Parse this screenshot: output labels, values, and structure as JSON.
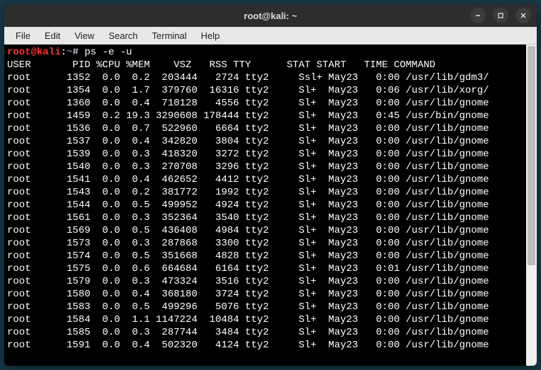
{
  "window": {
    "title": "root@kali: ~"
  },
  "menu": {
    "items": [
      "File",
      "Edit",
      "View",
      "Search",
      "Terminal",
      "Help"
    ]
  },
  "prompt": {
    "user": "root@kali",
    "sep1": ":",
    "path": "~",
    "sep2": "# ",
    "command": "ps -e -u"
  },
  "columns": "USER       PID %CPU %MEM    VSZ   RSS TTY      STAT START   TIME COMMAND",
  "processes": [
    {
      "user": "root",
      "pid": 1352,
      "cpu": "0.0",
      "mem": "0.2",
      "vsz": 203444,
      "rss": 2724,
      "tty": "tty2",
      "stat": "Ssl+",
      "start": "May23",
      "time": "0:00",
      "command": "/usr/lib/gdm3/"
    },
    {
      "user": "root",
      "pid": 1354,
      "cpu": "0.0",
      "mem": "1.7",
      "vsz": 379760,
      "rss": 16316,
      "tty": "tty2",
      "stat": "Sl+",
      "start": "May23",
      "time": "0:06",
      "command": "/usr/lib/xorg/"
    },
    {
      "user": "root",
      "pid": 1360,
      "cpu": "0.0",
      "mem": "0.4",
      "vsz": 710128,
      "rss": 4556,
      "tty": "tty2",
      "stat": "Sl+",
      "start": "May23",
      "time": "0:00",
      "command": "/usr/lib/gnome"
    },
    {
      "user": "root",
      "pid": 1459,
      "cpu": "0.2",
      "mem": "19.3",
      "vsz": 3290608,
      "rss": 178444,
      "tty": "tty2",
      "stat": "Sl+",
      "start": "May23",
      "time": "0:45",
      "command": "/usr/bin/gnome"
    },
    {
      "user": "root",
      "pid": 1536,
      "cpu": "0.0",
      "mem": "0.7",
      "vsz": 522960,
      "rss": 6664,
      "tty": "tty2",
      "stat": "Sl+",
      "start": "May23",
      "time": "0:00",
      "command": "/usr/lib/gnome"
    },
    {
      "user": "root",
      "pid": 1537,
      "cpu": "0.0",
      "mem": "0.4",
      "vsz": 342820,
      "rss": 3804,
      "tty": "tty2",
      "stat": "Sl+",
      "start": "May23",
      "time": "0:00",
      "command": "/usr/lib/gnome"
    },
    {
      "user": "root",
      "pid": 1539,
      "cpu": "0.0",
      "mem": "0.3",
      "vsz": 418320,
      "rss": 3272,
      "tty": "tty2",
      "stat": "Sl+",
      "start": "May23",
      "time": "0:00",
      "command": "/usr/lib/gnome"
    },
    {
      "user": "root",
      "pid": 1540,
      "cpu": "0.0",
      "mem": "0.3",
      "vsz": 270708,
      "rss": 3296,
      "tty": "tty2",
      "stat": "Sl+",
      "start": "May23",
      "time": "0:00",
      "command": "/usr/lib/gnome"
    },
    {
      "user": "root",
      "pid": 1541,
      "cpu": "0.0",
      "mem": "0.4",
      "vsz": 462652,
      "rss": 4412,
      "tty": "tty2",
      "stat": "Sl+",
      "start": "May23",
      "time": "0:00",
      "command": "/usr/lib/gnome"
    },
    {
      "user": "root",
      "pid": 1543,
      "cpu": "0.0",
      "mem": "0.2",
      "vsz": 381772,
      "rss": 1992,
      "tty": "tty2",
      "stat": "Sl+",
      "start": "May23",
      "time": "0:00",
      "command": "/usr/lib/gnome"
    },
    {
      "user": "root",
      "pid": 1544,
      "cpu": "0.0",
      "mem": "0.5",
      "vsz": 499952,
      "rss": 4924,
      "tty": "tty2",
      "stat": "Sl+",
      "start": "May23",
      "time": "0:00",
      "command": "/usr/lib/gnome"
    },
    {
      "user": "root",
      "pid": 1561,
      "cpu": "0.0",
      "mem": "0.3",
      "vsz": 352364,
      "rss": 3540,
      "tty": "tty2",
      "stat": "Sl+",
      "start": "May23",
      "time": "0:00",
      "command": "/usr/lib/gnome"
    },
    {
      "user": "root",
      "pid": 1569,
      "cpu": "0.0",
      "mem": "0.5",
      "vsz": 436408,
      "rss": 4984,
      "tty": "tty2",
      "stat": "Sl+",
      "start": "May23",
      "time": "0:00",
      "command": "/usr/lib/gnome"
    },
    {
      "user": "root",
      "pid": 1573,
      "cpu": "0.0",
      "mem": "0.3",
      "vsz": 287868,
      "rss": 3300,
      "tty": "tty2",
      "stat": "Sl+",
      "start": "May23",
      "time": "0:00",
      "command": "/usr/lib/gnome"
    },
    {
      "user": "root",
      "pid": 1574,
      "cpu": "0.0",
      "mem": "0.5",
      "vsz": 351668,
      "rss": 4828,
      "tty": "tty2",
      "stat": "Sl+",
      "start": "May23",
      "time": "0:00",
      "command": "/usr/lib/gnome"
    },
    {
      "user": "root",
      "pid": 1575,
      "cpu": "0.0",
      "mem": "0.6",
      "vsz": 664684,
      "rss": 6164,
      "tty": "tty2",
      "stat": "Sl+",
      "start": "May23",
      "time": "0:01",
      "command": "/usr/lib/gnome"
    },
    {
      "user": "root",
      "pid": 1579,
      "cpu": "0.0",
      "mem": "0.3",
      "vsz": 473324,
      "rss": 3516,
      "tty": "tty2",
      "stat": "Sl+",
      "start": "May23",
      "time": "0:00",
      "command": "/usr/lib/gnome"
    },
    {
      "user": "root",
      "pid": 1580,
      "cpu": "0.0",
      "mem": "0.4",
      "vsz": 368180,
      "rss": 3724,
      "tty": "tty2",
      "stat": "Sl+",
      "start": "May23",
      "time": "0:00",
      "command": "/usr/lib/gnome"
    },
    {
      "user": "root",
      "pid": 1583,
      "cpu": "0.0",
      "mem": "0.5",
      "vsz": 499296,
      "rss": 5076,
      "tty": "tty2",
      "stat": "Sl+",
      "start": "May23",
      "time": "0:00",
      "command": "/usr/lib/gnome"
    },
    {
      "user": "root",
      "pid": 1584,
      "cpu": "0.0",
      "mem": "1.1",
      "vsz": 1147224,
      "rss": 10484,
      "tty": "tty2",
      "stat": "Sl+",
      "start": "May23",
      "time": "0:00",
      "command": "/usr/lib/gnome"
    },
    {
      "user": "root",
      "pid": 1585,
      "cpu": "0.0",
      "mem": "0.3",
      "vsz": 287744,
      "rss": 3484,
      "tty": "tty2",
      "stat": "Sl+",
      "start": "May23",
      "time": "0:00",
      "command": "/usr/lib/gnome"
    },
    {
      "user": "root",
      "pid": 1591,
      "cpu": "0.0",
      "mem": "0.4",
      "vsz": 502320,
      "rss": 4124,
      "tty": "tty2",
      "stat": "Sl+",
      "start": "May23",
      "time": "0:00",
      "command": "/usr/lib/gnome"
    }
  ],
  "colors": {
    "prompt_user": "#ff3030",
    "prompt_path": "#6fa8ff",
    "fg": "#ffffff",
    "bg": "#000000"
  }
}
